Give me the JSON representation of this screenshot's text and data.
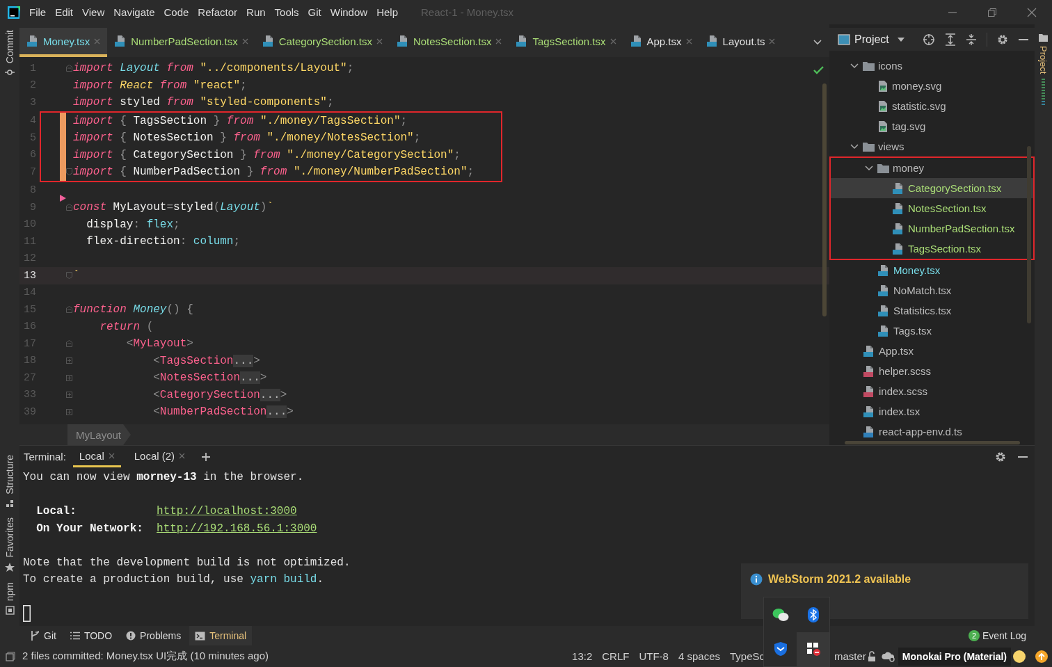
{
  "window": {
    "title": "React-1 - Money.tsx",
    "menu": [
      "File",
      "Edit",
      "View",
      "Navigate",
      "Code",
      "Refactor",
      "Run",
      "Tools",
      "Git",
      "Window",
      "Help"
    ]
  },
  "left_toolbar": {
    "top": [
      {
        "label": "Commit",
        "kind": "commit"
      }
    ],
    "bottom": [
      {
        "label": "Structure",
        "kind": "structure"
      },
      {
        "label": "Favorites",
        "kind": "star"
      },
      {
        "label": "npm",
        "kind": "npm"
      }
    ]
  },
  "editor_tabs": [
    {
      "label": "Money.tsx",
      "selected": true,
      "added": false,
      "modified": true
    },
    {
      "label": "NumberPadSection.tsx",
      "selected": false,
      "added": true,
      "modified": false
    },
    {
      "label": "CategorySection.tsx",
      "selected": false,
      "added": true,
      "modified": false
    },
    {
      "label": "NotesSection.tsx",
      "selected": false,
      "added": true,
      "modified": false
    },
    {
      "label": "TagsSection.tsx",
      "selected": false,
      "added": true,
      "modified": false
    },
    {
      "label": "App.tsx",
      "selected": false,
      "added": false,
      "modified": false
    },
    {
      "label": "Layout.ts",
      "selected": false,
      "added": false,
      "modified": false
    }
  ],
  "editor": {
    "lines": [
      {
        "number": "1",
        "kind": "fold-start",
        "current": false,
        "changed": false,
        "marked": false,
        "run_marker": false,
        "tokens": [
          {
            "kind": "k",
            "text": "import "
          },
          {
            "kind": "t",
            "text": "Layout "
          },
          {
            "kind": "k",
            "text": "from "
          },
          {
            "kind": "s",
            "text": "\"../components/Layout\""
          },
          {
            "kind": "u",
            "text": ";"
          }
        ]
      },
      {
        "number": "2",
        "kind": "plain",
        "current": false,
        "changed": false,
        "marked": false,
        "run_marker": false,
        "tokens": [
          {
            "kind": "k",
            "text": "import "
          },
          {
            "kind": "c",
            "text": "React "
          },
          {
            "kind": "k",
            "text": "from "
          },
          {
            "kind": "s",
            "text": "\"react\""
          },
          {
            "kind": "u",
            "text": ";"
          }
        ]
      },
      {
        "number": "3",
        "kind": "plain",
        "current": false,
        "changed": false,
        "marked": false,
        "run_marker": false,
        "tokens": [
          {
            "kind": "k",
            "text": "import "
          },
          {
            "kind": "p",
            "text": "styled "
          },
          {
            "kind": "k",
            "text": "from "
          },
          {
            "kind": "s",
            "text": "\"styled-components\""
          },
          {
            "kind": "u",
            "text": ";"
          }
        ]
      },
      {
        "number": "4",
        "kind": "plain",
        "current": false,
        "changed": true,
        "marked": true,
        "run_marker": false,
        "tokens": [
          {
            "kind": "k",
            "text": "import "
          },
          {
            "kind": "u",
            "text": "{ "
          },
          {
            "kind": "p",
            "text": "TagsSection"
          },
          {
            "kind": "u",
            "text": " } "
          },
          {
            "kind": "k",
            "text": "from "
          },
          {
            "kind": "s",
            "text": "\"./money/TagsSection\""
          },
          {
            "kind": "u",
            "text": ";"
          }
        ]
      },
      {
        "number": "5",
        "kind": "plain",
        "current": false,
        "changed": true,
        "marked": true,
        "run_marker": false,
        "tokens": [
          {
            "kind": "k",
            "text": "import "
          },
          {
            "kind": "u",
            "text": "{ "
          },
          {
            "kind": "p",
            "text": "NotesSection"
          },
          {
            "kind": "u",
            "text": " } "
          },
          {
            "kind": "k",
            "text": "from "
          },
          {
            "kind": "s",
            "text": "\"./money/NotesSection\""
          },
          {
            "kind": "u",
            "text": ";"
          }
        ]
      },
      {
        "number": "6",
        "kind": "plain",
        "current": false,
        "changed": true,
        "marked": true,
        "run_marker": false,
        "tokens": [
          {
            "kind": "k",
            "text": "import "
          },
          {
            "kind": "u",
            "text": "{ "
          },
          {
            "kind": "p",
            "text": "CategorySection"
          },
          {
            "kind": "u",
            "text": " } "
          },
          {
            "kind": "k",
            "text": "from "
          },
          {
            "kind": "s",
            "text": "\"./money/CategorySection\""
          },
          {
            "kind": "u",
            "text": ";"
          }
        ]
      },
      {
        "number": "7",
        "kind": "fold-end",
        "current": false,
        "changed": true,
        "marked": true,
        "run_marker": false,
        "tokens": [
          {
            "kind": "k",
            "text": "import "
          },
          {
            "kind": "u",
            "text": "{ "
          },
          {
            "kind": "p",
            "text": "NumberPadSection"
          },
          {
            "kind": "u",
            "text": " } "
          },
          {
            "kind": "k",
            "text": "from "
          },
          {
            "kind": "s",
            "text": "\"./money/NumberPadSection\""
          },
          {
            "kind": "u",
            "text": ";"
          }
        ]
      },
      {
        "number": "8",
        "kind": "plain",
        "current": false,
        "changed": false,
        "marked": false,
        "run_marker": false
      },
      {
        "number": "9",
        "kind": "fold-start",
        "current": false,
        "changed": false,
        "marked": false,
        "run_marker": true,
        "tokens": [
          {
            "kind": "k",
            "text": "const "
          },
          {
            "kind": "p",
            "text": "MyLayout"
          },
          {
            "kind": "u",
            "text": "="
          },
          {
            "kind": "p",
            "text": "styled"
          },
          {
            "kind": "u",
            "text": "("
          },
          {
            "kind": "t",
            "text": "Layout"
          },
          {
            "kind": "u",
            "text": ")"
          },
          {
            "kind": "s",
            "text": "`"
          }
        ]
      },
      {
        "number": "10",
        "kind": "plain",
        "current": false,
        "changed": false,
        "marked": false,
        "run_marker": false,
        "tokens": [
          {
            "kind": "p",
            "text": "  display"
          },
          {
            "kind": "u",
            "text": ": "
          },
          {
            "kind": "v",
            "text": "flex"
          },
          {
            "kind": "u",
            "text": ";"
          }
        ]
      },
      {
        "number": "11",
        "kind": "plain",
        "current": false,
        "changed": false,
        "marked": false,
        "run_marker": false,
        "tokens": [
          {
            "kind": "p",
            "text": "  flex-direction"
          },
          {
            "kind": "u",
            "text": ": "
          },
          {
            "kind": "v",
            "text": "column"
          },
          {
            "kind": "u",
            "text": ";"
          }
        ]
      },
      {
        "number": "12",
        "kind": "plain",
        "current": false,
        "changed": false,
        "marked": false,
        "run_marker": false
      },
      {
        "number": "13",
        "kind": "fold-end",
        "current": true,
        "changed": false,
        "marked": false,
        "run_marker": false,
        "tokens": [
          {
            "kind": "s",
            "text": "`"
          }
        ]
      },
      {
        "number": "14",
        "kind": "plain",
        "current": false,
        "changed": false,
        "marked": false,
        "run_marker": false
      },
      {
        "number": "15",
        "kind": "fold-start",
        "current": false,
        "changed": false,
        "marked": false,
        "run_marker": false,
        "tokens": [
          {
            "kind": "k",
            "text": "function "
          },
          {
            "kind": "t",
            "text": "Money"
          },
          {
            "kind": "u",
            "text": "() {"
          }
        ]
      },
      {
        "number": "16",
        "kind": "plain",
        "current": false,
        "changed": false,
        "marked": false,
        "run_marker": false,
        "tokens": [
          {
            "kind": "k",
            "text": "    return "
          },
          {
            "kind": "u",
            "text": "("
          }
        ]
      },
      {
        "number": "17",
        "kind": "fold-start",
        "current": false,
        "changed": false,
        "marked": false,
        "run_marker": false,
        "tokens": [
          {
            "kind": "u",
            "text": "        <"
          },
          {
            "kind": "g",
            "text": "MyLayout"
          },
          {
            "kind": "u",
            "text": ">"
          }
        ]
      },
      {
        "number": "18",
        "kind": "folded",
        "current": false,
        "changed": false,
        "marked": false,
        "run_marker": false,
        "tokens": [
          {
            "kind": "u",
            "text": "            <"
          },
          {
            "kind": "g",
            "text": "TagsSection"
          },
          {
            "kind": "f",
            "text": "..."
          },
          {
            "kind": "u",
            "text": ">"
          }
        ]
      },
      {
        "number": "27",
        "kind": "folded",
        "current": false,
        "changed": false,
        "marked": false,
        "run_marker": false,
        "tokens": [
          {
            "kind": "u",
            "text": "            <"
          },
          {
            "kind": "g",
            "text": "NotesSection"
          },
          {
            "kind": "f",
            "text": "..."
          },
          {
            "kind": "u",
            "text": ">"
          }
        ]
      },
      {
        "number": "33",
        "kind": "folded",
        "current": false,
        "changed": false,
        "marked": false,
        "run_marker": false,
        "tokens": [
          {
            "kind": "u",
            "text": "            <"
          },
          {
            "kind": "g",
            "text": "CategorySection"
          },
          {
            "kind": "f",
            "text": "..."
          },
          {
            "kind": "u",
            "text": ">"
          }
        ]
      },
      {
        "number": "39",
        "kind": "folded",
        "current": false,
        "changed": false,
        "marked": false,
        "run_marker": false,
        "tokens": [
          {
            "kind": "u",
            "text": "            <"
          },
          {
            "kind": "g",
            "text": "NumberPadSection"
          },
          {
            "kind": "f",
            "text": "..."
          },
          {
            "kind": "u",
            "text": ">"
          }
        ]
      }
    ],
    "breadcrumb": [
      "MyLayout"
    ]
  },
  "project": {
    "title": "Project",
    "tree": [
      {
        "label": "icons",
        "kind": "folder",
        "expanded": true,
        "selected": false,
        "marked": false,
        "children": [
          {
            "label": "money.svg",
            "kind": "svg",
            "selected": false,
            "marked": false,
            "added": false,
            "modified": false
          },
          {
            "label": "statistic.svg",
            "kind": "svg",
            "selected": false,
            "marked": false,
            "added": false,
            "modified": false
          },
          {
            "label": "tag.svg",
            "kind": "svg",
            "selected": false,
            "marked": false,
            "added": false,
            "modified": false
          }
        ]
      },
      {
        "label": "views",
        "kind": "folder",
        "expanded": true,
        "selected": false,
        "marked": false,
        "children": [
          {
            "label": "money",
            "kind": "folder",
            "expanded": true,
            "selected": false,
            "marked": true,
            "children": [
              {
                "label": "CategorySection.tsx",
                "kind": "tsx",
                "selected": true,
                "marked": false,
                "added": true,
                "modified": false
              },
              {
                "label": "NotesSection.tsx",
                "kind": "tsx",
                "selected": false,
                "marked": false,
                "added": true,
                "modified": false
              },
              {
                "label": "NumberPadSection.tsx",
                "kind": "tsx",
                "selected": false,
                "marked": false,
                "added": true,
                "modified": false
              },
              {
                "label": "TagsSection.tsx",
                "kind": "tsx",
                "selected": false,
                "marked": false,
                "added": true,
                "modified": false
              }
            ]
          },
          {
            "label": "Money.tsx",
            "kind": "tsx",
            "selected": false,
            "marked": false,
            "added": false,
            "modified": true
          },
          {
            "label": "NoMatch.tsx",
            "kind": "tsx",
            "selected": false,
            "marked": false,
            "added": false,
            "modified": false
          },
          {
            "label": "Statistics.tsx",
            "kind": "tsx",
            "selected": false,
            "marked": false,
            "added": false,
            "modified": false
          },
          {
            "label": "Tags.tsx",
            "kind": "tsx",
            "selected": false,
            "marked": false,
            "added": false,
            "modified": false
          }
        ]
      },
      {
        "label": "App.tsx",
        "kind": "tsx",
        "selected": false,
        "marked": false,
        "added": false,
        "modified": false
      },
      {
        "label": "helper.scss",
        "kind": "scss",
        "selected": false,
        "marked": false,
        "added": false,
        "modified": false
      },
      {
        "label": "index.scss",
        "kind": "scss",
        "selected": false,
        "marked": false,
        "added": false,
        "modified": false
      },
      {
        "label": "index.tsx",
        "kind": "tsx",
        "selected": false,
        "marked": false,
        "added": false,
        "modified": false
      },
      {
        "label": "react-app-env.d.ts",
        "kind": "ts",
        "selected": false,
        "marked": false,
        "added": false,
        "modified": false
      }
    ]
  },
  "right_toolbar": [
    {
      "label": "Project"
    }
  ],
  "terminal": {
    "label": "Terminal:",
    "tabs": [
      {
        "label": "Local",
        "selected": true
      },
      {
        "label": "Local (2)",
        "selected": false
      }
    ],
    "blocks": [
      [
        [
          {
            "kind": "p",
            "text": "You can now view "
          },
          {
            "kind": "b",
            "text": "morney-13"
          },
          {
            "kind": "p",
            "text": " in the browser."
          }
        ]
      ],
      [
        [
          {
            "kind": "b",
            "text": "  Local:            "
          },
          {
            "kind": "l",
            "text": "http://localhost:3000"
          }
        ],
        [
          {
            "kind": "b",
            "text": "  On Your Network:  "
          },
          {
            "kind": "l",
            "text": "http://192.168.56.1:3000"
          }
        ]
      ],
      [
        [
          {
            "kind": "p",
            "text": "Note that the development build is not optimized."
          }
        ],
        [
          {
            "kind": "p",
            "text": "To create a production build, use "
          },
          {
            "kind": "c",
            "text": "yarn build"
          },
          {
            "kind": "p",
            "text": "."
          }
        ]
      ]
    ]
  },
  "tool_windows": [
    {
      "label": "Git",
      "kind": "git",
      "selected": false
    },
    {
      "label": "TODO",
      "kind": "list",
      "selected": false
    },
    {
      "label": "Problems",
      "kind": "problems",
      "selected": false
    },
    {
      "label": "Terminal",
      "kind": "terminal",
      "selected": true
    }
  ],
  "event_log": {
    "count": "2",
    "label": "Event Log"
  },
  "notification": {
    "title": "WebStorm 2021.2 available"
  },
  "status_bar": {
    "message": "2 files committed: Money.tsx UI完成 (10 minutes ago)",
    "items": [
      "13:2",
      "CRLF",
      "UTF-8",
      "4 spaces",
      "TypeSc"
    ],
    "branch": "master",
    "theme": "Monokai Pro (Material)"
  }
}
